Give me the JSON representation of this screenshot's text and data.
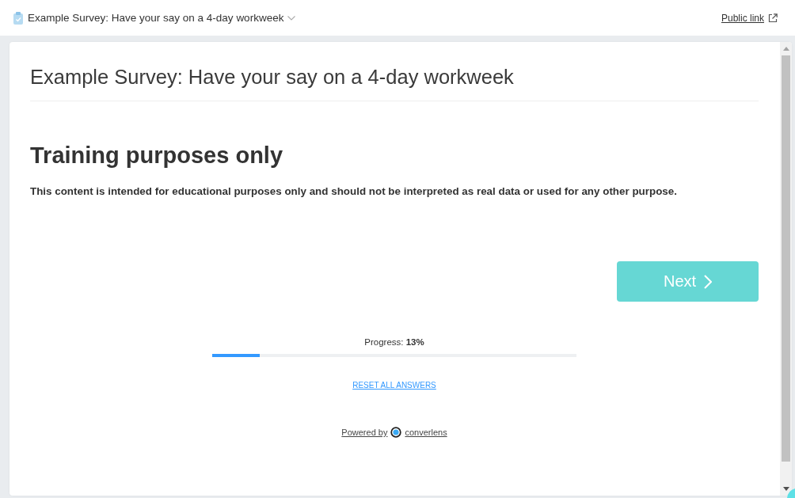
{
  "header": {
    "title": "Example Survey: Have your say on a 4-day workweek",
    "public_link": "Public link"
  },
  "survey": {
    "title": "Example Survey: Have your say on a 4-day workweek",
    "heading": "Training purposes only",
    "body": "This content is intended for educational purposes only and should not be interpreted as real data or used for any other purpose.",
    "next_button": "Next",
    "progress": {
      "label": "Progress: **13%**",
      "level": 0.13
    },
    "reset_link": "RESET ALL ANSWERS",
    "powered_by": {
      "prefix": "Powered by",
      "brand": "converlens"
    }
  }
}
